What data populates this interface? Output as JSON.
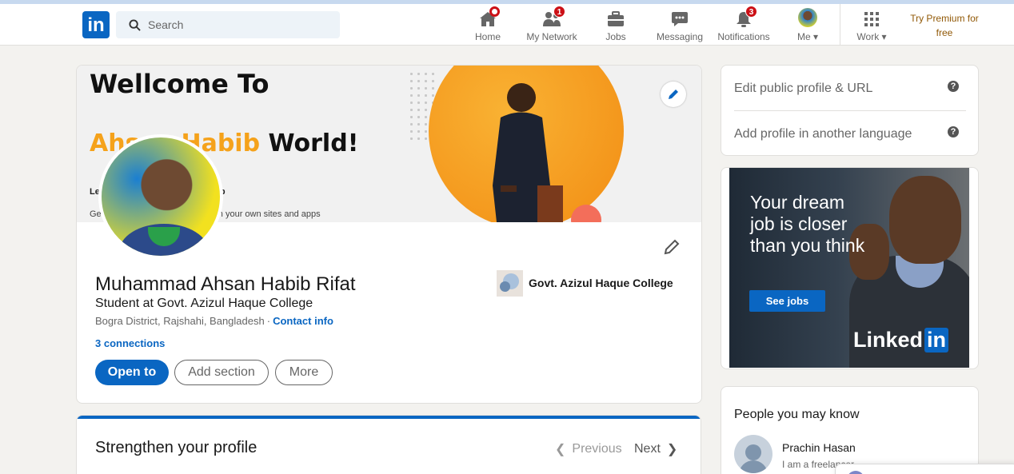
{
  "nav": {
    "search_placeholder": "Search",
    "items": [
      {
        "label": "Home",
        "icon": "home-icon"
      },
      {
        "label": "My Network",
        "icon": "network-icon",
        "badge": "1"
      },
      {
        "label": "Jobs",
        "icon": "briefcase-icon"
      },
      {
        "label": "Messaging",
        "icon": "messaging-icon"
      },
      {
        "label": "Notifications",
        "icon": "bell-icon",
        "badge": "3"
      },
      {
        "label": "Me",
        "icon": "avatar-icon"
      },
      {
        "label": "Work",
        "icon": "grid-icon"
      }
    ],
    "premium": "Try Premium for free"
  },
  "banner": {
    "title": "Wellcome To",
    "sub_orange": "Ahsan Habib",
    "sub_dark": " World!",
    "small1": "Le",
    "small1_end": "b",
    "small2_start": "Ge",
    "small2_end": "on your own sites and apps"
  },
  "profile": {
    "name": "Muhammad Ahsan Habib Rifat",
    "headline": "Student at Govt. Azizul Haque College",
    "location": "Bogra District, Rajshahi, Bangladesh",
    "separator": "·",
    "contact_info": "Contact info",
    "connections": "3 connections",
    "open_to": "Open to",
    "add_section": "Add section",
    "more": "More",
    "college": "Govt. Azizul Haque College"
  },
  "strengthen": {
    "title": "Strengthen your profile",
    "previous": "Previous",
    "next": "Next"
  },
  "sidebar": {
    "edit_url": "Edit public profile & URL",
    "add_language": "Add profile in another language",
    "help_glyph": "?"
  },
  "ad": {
    "headline": "Your dream job is closer than you think",
    "cta": "See jobs",
    "logo_main": "Linked",
    "logo_box": "in"
  },
  "pymk": {
    "title": "People you may know",
    "person_name": "Prachin Hasan",
    "person_headline": "I am a freelancer"
  },
  "colors": {
    "brand": "#0a66c2",
    "badge": "#cc1016",
    "banner_orange": "#f5a21b",
    "premium": "#915907"
  }
}
